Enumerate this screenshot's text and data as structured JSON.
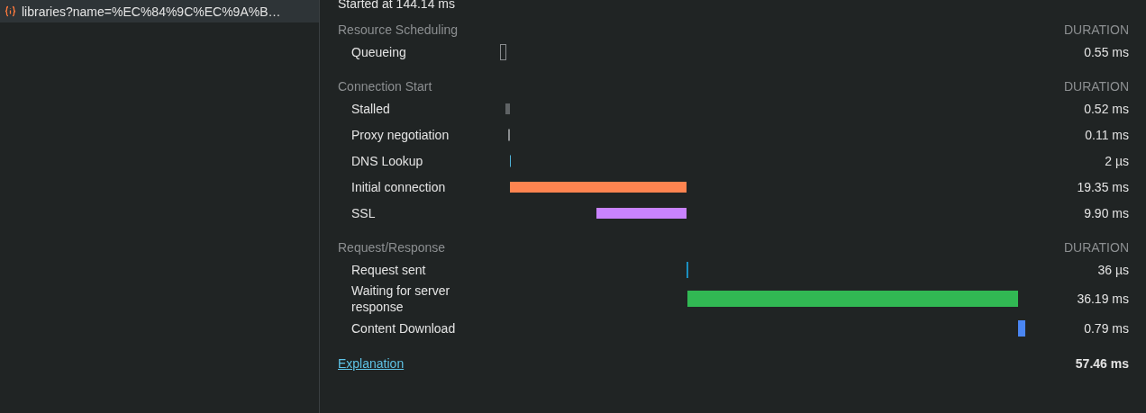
{
  "sidebar": {
    "items": [
      {
        "label": "libraries?name=%EC%84%9C%EC%9A%B…",
        "selected": true
      }
    ]
  },
  "started": "Started at 144.14 ms",
  "sections": [
    {
      "title": "Resource Scheduling",
      "column": "DURATION",
      "rows": [
        {
          "label": "Queueing",
          "duration": "0.55 ms",
          "color": "#8a8d8f",
          "kind": "outline"
        }
      ]
    },
    {
      "title": "Connection Start",
      "column": "DURATION",
      "rows": [
        {
          "label": "Stalled",
          "duration": "0.52 ms",
          "color": "#5f6365",
          "kind": "solid"
        },
        {
          "label": "Proxy negotiation",
          "duration": "0.11 ms",
          "color": "#8a8d8f",
          "kind": "solid"
        },
        {
          "label": "DNS Lookup",
          "duration": "2 µs",
          "color": "#4fb3d9",
          "kind": "solid"
        },
        {
          "label": "Initial connection",
          "duration": "19.35 ms",
          "color": "#ff8450",
          "kind": "solid"
        },
        {
          "label": "SSL",
          "duration": "9.90 ms",
          "color": "#c983ff",
          "kind": "solid"
        }
      ]
    },
    {
      "title": "Request/Response",
      "column": "DURATION",
      "rows": [
        {
          "label": "Request sent",
          "duration": "36 µs",
          "color": "#1b8fc0",
          "kind": "solid"
        },
        {
          "label": "Waiting for server response",
          "duration": "36.19 ms",
          "color": "#31b853",
          "kind": "solid"
        },
        {
          "label": "Content Download",
          "duration": "0.79 ms",
          "color": "#4a86f2",
          "kind": "solid"
        }
      ]
    }
  ],
  "explanation": "Explanation",
  "total": "57.46 ms"
}
